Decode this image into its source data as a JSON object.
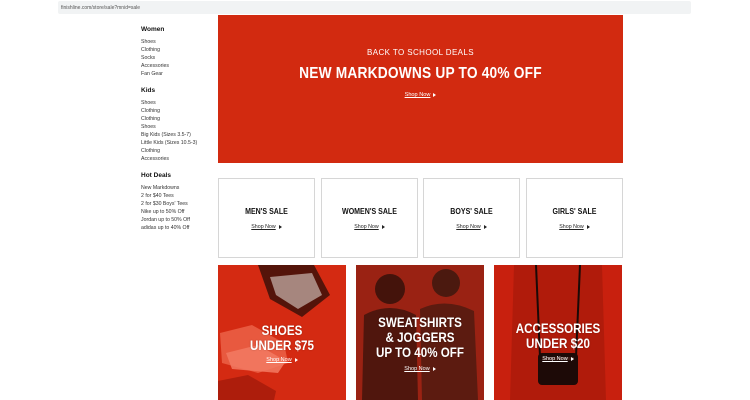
{
  "browser": {
    "url": "finishline.com/store/sale?mnid=sale"
  },
  "sidebar": {
    "groups": [
      {
        "heading": "Women",
        "links": [
          "Shoes",
          "Clothing",
          "Socks",
          "Accessories",
          "Fan Gear"
        ]
      },
      {
        "heading": "Kids",
        "links": [
          "Shoes",
          "Clothing",
          "Clothing",
          "Shoes",
          "Big Kids (Sizes 3.5-7)",
          "Little Kids (Sizes 10.5-3)",
          "Clothing",
          "Accessories"
        ]
      },
      {
        "heading": "Hot Deals",
        "links": [
          "New Markdowns",
          "2 for $40 Tees",
          "2 for $30 Boys' Tees",
          "Nike up to 50% Off",
          "Jordan up to 50% Off",
          "adidas up to 40% Off"
        ]
      }
    ]
  },
  "hero": {
    "eyebrow": "BACK TO SCHOOL DEALS",
    "title": "NEW MARKDOWNS UP TO 40% OFF",
    "cta": "Shop Now",
    "color": "#d22a10"
  },
  "categories": [
    {
      "title": "MEN'S SALE",
      "cta": "Shop Now"
    },
    {
      "title": "WOMEN'S SALE",
      "cta": "Shop Now"
    },
    {
      "title": "BOYS' SALE",
      "cta": "Shop Now"
    },
    {
      "title": "GIRLS' SALE",
      "cta": "Shop Now"
    }
  ],
  "promos": [
    {
      "line1": "SHOES",
      "line2": "UNDER $75",
      "line3": "",
      "cta": "Shop Now",
      "color": "#d42a12"
    },
    {
      "line1": "SWEATSHIRTS",
      "line2": "& JOGGERS",
      "line3": "UP TO 40% OFF",
      "cta": "Shop Now",
      "color": "#8e1d10"
    },
    {
      "line1": "ACCESSORIES",
      "line2": "UNDER $20",
      "line3": "",
      "cta": "Shop Now",
      "color": "#c8200e"
    }
  ]
}
